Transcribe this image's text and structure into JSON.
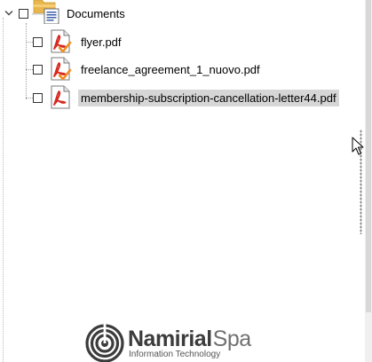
{
  "tree": {
    "root": {
      "label": "Documents",
      "expanded": true,
      "checked": false,
      "icon": "folder-documents-icon"
    },
    "items": [
      {
        "label": "flyer.pdf",
        "checked": false,
        "selected": false,
        "icon": "pdf-signed-icon"
      },
      {
        "label": "freelance_agreement_1_nuovo.pdf",
        "checked": false,
        "selected": false,
        "icon": "pdf-signed-icon"
      },
      {
        "label": "membership-subscription-cancellation-letter44.pdf",
        "checked": false,
        "selected": true,
        "icon": "pdf-icon"
      }
    ]
  },
  "branding": {
    "name": "Namirial",
    "suffix": "Spa",
    "tagline": "Information Technology"
  },
  "colors": {
    "selection": "#d6d6d6",
    "pdf_red": "#d7281f",
    "signature_check": "#f08c1e",
    "folder": "#e8b64c",
    "logo_dark": "#3c3c3c"
  }
}
